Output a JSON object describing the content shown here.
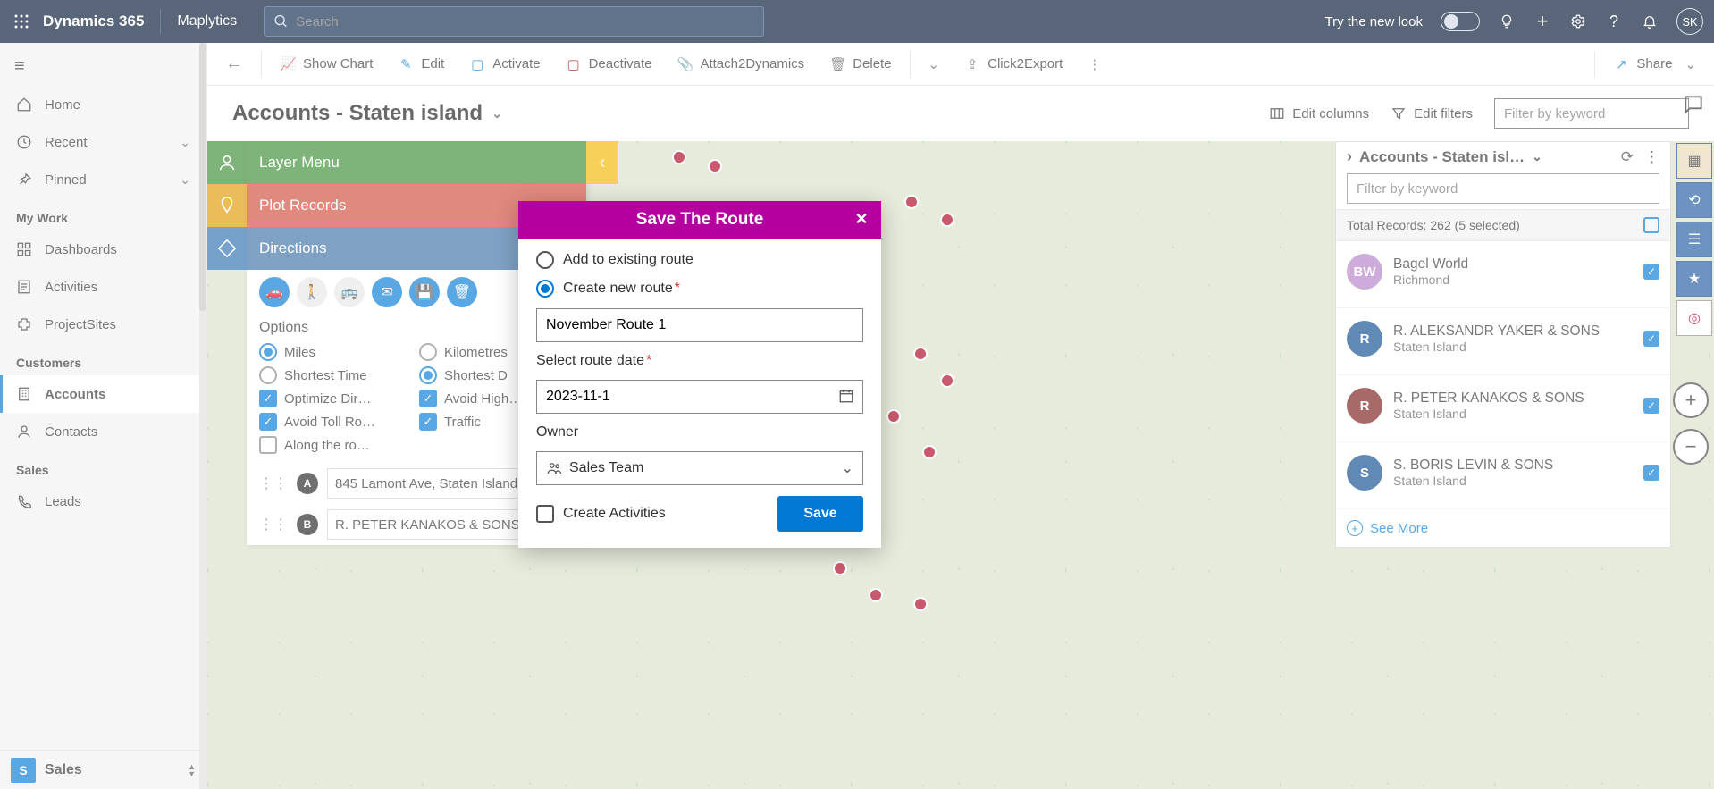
{
  "topbar": {
    "brand": "Dynamics 365",
    "app": "Maplytics",
    "search_placeholder": "Search",
    "trynew": "Try the new look",
    "avatar": "SK"
  },
  "leftnav": {
    "home": "Home",
    "recent": "Recent",
    "pinned": "Pinned",
    "group_mywork": "My Work",
    "dashboards": "Dashboards",
    "activities": "Activities",
    "projectsites": "ProjectSites",
    "group_customers": "Customers",
    "accounts": "Accounts",
    "contacts": "Contacts",
    "group_sales": "Sales",
    "leads": "Leads",
    "area_label": "Sales",
    "area_initial": "S"
  },
  "cmdbar": {
    "showchart": "Show Chart",
    "edit": "Edit",
    "activate": "Activate",
    "deactivate": "Deactivate",
    "attach": "Attach2Dynamics",
    "delete": "Delete",
    "click2export": "Click2Export",
    "share": "Share"
  },
  "header": {
    "title": "Accounts - Staten island",
    "editcols": "Edit columns",
    "editfilters": "Edit filters",
    "filter_placeholder": "Filter by keyword"
  },
  "mappanel": {
    "layer": "Layer Menu",
    "plot": "Plot Records",
    "directions": "Directions",
    "options_title": "Options",
    "miles": "Miles",
    "km": "Kilometres",
    "shortest_time": "Shortest Time",
    "shortest_d": "Shortest D",
    "optimize": "Optimize Dir…",
    "avoid_high": "Avoid High…",
    "avoid_toll": "Avoid Toll Ro…",
    "traffic": "Traffic",
    "along": "Along the ro…",
    "route_a": "845 Lamont Ave, Staten Island",
    "route_b": "R. PETER KANAKOS & SONS: 3"
  },
  "recpanel": {
    "title": "Accounts - Staten isl…",
    "filter_placeholder": "Filter by keyword",
    "total": "Total Records: 262 (5 selected)",
    "seemore": "See More",
    "rows": [
      {
        "initials": "BW",
        "name": "Bagel World",
        "sub": "Richmond",
        "bg": "#b27fc7"
      },
      {
        "initials": "R",
        "name": "R. ALEKSANDR YAKER & SONS",
        "sub": "Staten Island",
        "bg": "#0b4a8f"
      },
      {
        "initials": "R",
        "name": "R. PETER KANAKOS & SONS",
        "sub": "Staten Island",
        "bg": "#7a1a1a"
      },
      {
        "initials": "S",
        "name": "S. BORIS LEVIN & SONS",
        "sub": "Staten Island",
        "bg": "#0b4a8f"
      }
    ]
  },
  "modal": {
    "title": "Save The Route",
    "add_existing": "Add to existing route",
    "create_new": "Create new route",
    "name_value": "November Route 1",
    "date_label": "Select route date",
    "date_value": "2023-11-1",
    "owner_label": "Owner",
    "owner_value": "Sales Team",
    "create_activities": "Create Activities",
    "save": "Save"
  }
}
